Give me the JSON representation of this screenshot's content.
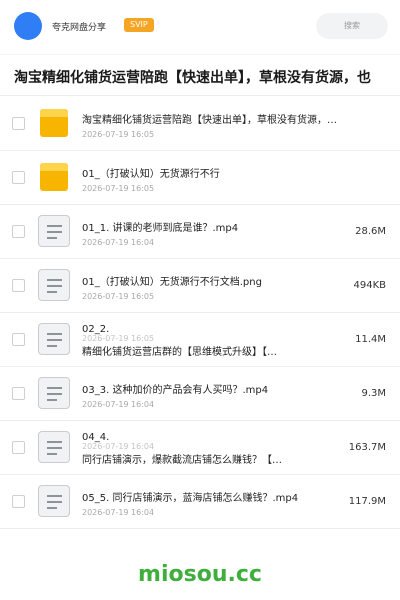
{
  "header": {
    "share_name": "夸克网盘分享",
    "badge": "SVIP",
    "search_placeholder": "搜索",
    "avatar_color": "#2f7ef5"
  },
  "title": "淘宝精细化铺货运营陪跑【快速出单】，草根没有货源，也",
  "files": [
    {
      "type": "folder",
      "name": "淘宝精细化铺货运营陪跑【快速出单】，草根没有货源，…",
      "date": "2026-07-19 16:05",
      "size": ""
    },
    {
      "type": "folder",
      "name": "01_（打破认知）无货源行不行",
      "date": "2026-07-19 16:05",
      "size": ""
    },
    {
      "type": "file",
      "name": "01_1. 讲课的老师到底是谁？.mp4",
      "date": "2026-07-19 16:04",
      "size": "28.6M"
    },
    {
      "type": "file",
      "name": "01_（打破认知）无货源行不行文档.png",
      "date": "2026-07-19 16:05",
      "size": "494KB"
    },
    {
      "type": "file-split",
      "name1": "02_2.",
      "name2": "精细化铺货运营店群的【思维模式升级】【…",
      "date": "2026-07-19 16:05",
      "size": "11.4M"
    },
    {
      "type": "file",
      "name": "03_3. 这种加价的产品会有人买吗？.mp4",
      "date": "2026-07-19 16:04",
      "size": "9.3M"
    },
    {
      "type": "file-split",
      "name1": "04_4.",
      "name2": "同行店铺演示，爆款截流店铺怎么赚钱？【…",
      "date": "2026-07-19 16:04",
      "size": "163.7M"
    },
    {
      "type": "file",
      "name": "05_5. 同行店铺演示，蓝海店铺怎么赚钱？.mp4",
      "date": "2026-07-19 16:04",
      "size": "117.9M"
    }
  ],
  "watermark": "miosou.cc"
}
